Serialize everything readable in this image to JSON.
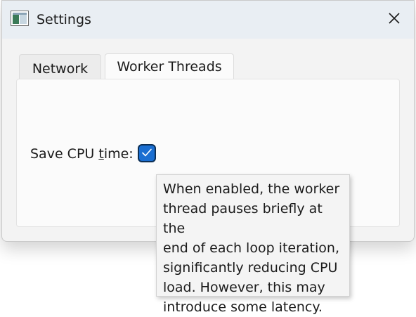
{
  "window": {
    "title": "Settings"
  },
  "tabs": [
    {
      "label": "Network",
      "selected": false
    },
    {
      "label": "Worker Threads",
      "selected": true
    }
  ],
  "worker_threads": {
    "save_cpu_label_before": "Save CPU ",
    "save_cpu_label_mnemonic": "t",
    "save_cpu_label_after": "ime:",
    "save_cpu_checked": true,
    "tooltip": "When enabled, the worker\nthread pauses briefly at the\nend of each loop iteration,\nsignificantly reducing CPU\nload. However, this may\nintroduce some latency."
  },
  "colors": {
    "accent": "#1a6ed1",
    "titlebar": "#e9eef3"
  },
  "icons": {
    "app": "settings-window-icon",
    "close": "close-icon",
    "check": "checkmark-icon"
  }
}
